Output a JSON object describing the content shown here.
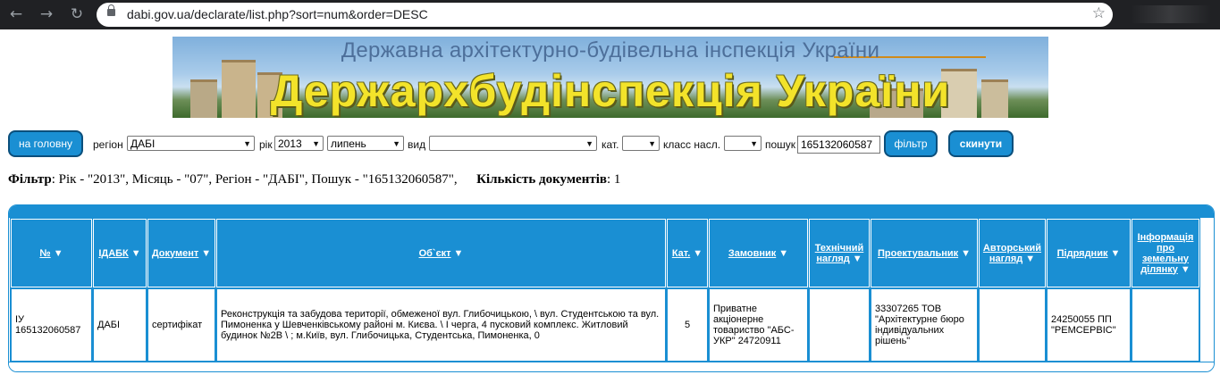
{
  "browser": {
    "url": "dabi.gov.ua/declarate/list.php?sort=num&order=DESC"
  },
  "banner": {
    "subtitle": "Державна архітектурно-будівельна інспекція України",
    "title": "Держархбудінспекція України"
  },
  "filters": {
    "home_button": "на головну",
    "region_label": "регіон",
    "region_value": "ДАБІ",
    "year_label": "рік",
    "year_value": "2013",
    "month_value": "липень",
    "kind_label": "вид",
    "kind_value": "",
    "cat_label": "кат.",
    "cat_value": "",
    "class_label": "класс насл.",
    "class_value": "",
    "search_label": "пошук",
    "search_value": "165132060587",
    "filter_button": "фільтр",
    "reset_button": "скинути"
  },
  "summary": {
    "filter_label": "Фільтр",
    "filter_text": ": Рік - \"2013\", Місяць - \"07\", Регіон - \"ДАБІ\", Пошук - \"165132060587\",",
    "count_label": "Кількість документів",
    "count_text": ": 1"
  },
  "table": {
    "columns": [
      "№",
      "ІДАБК",
      "Документ",
      "Об`єкт",
      "Кат.",
      "Замовник",
      "Технічний нагляд",
      "Проектувальник",
      "Авторський нагляд",
      "Підрядник",
      "Інформація про земельну ділянку"
    ],
    "rows": [
      {
        "num": "ІУ 165132060587",
        "idabk": "ДАБІ",
        "doc": "сертифікат",
        "object": "Реконструкція та забудова території, обмеженої вул. Глибочицькою, \\ вул. Студентською та вул. Пимоненка у Шевченківському районі м. Києва. \\ I черга, 4 пусковий комплекс. Житловий будинок №2В \\ ; м.Київ, вул. Глибочицька, Студентська, Пимоненка, 0",
        "cat": "5",
        "customer": "Приватне акціонерне товариство \"АБС-УКР\" 24720911",
        "tech": "",
        "designer": "33307265 ТОВ \"Архітектурне бюро індивідуальних рішень\"",
        "author": "",
        "contractor": "24250055 ПП \"РЕМСЕРВІС\"",
        "land": ""
      }
    ]
  }
}
